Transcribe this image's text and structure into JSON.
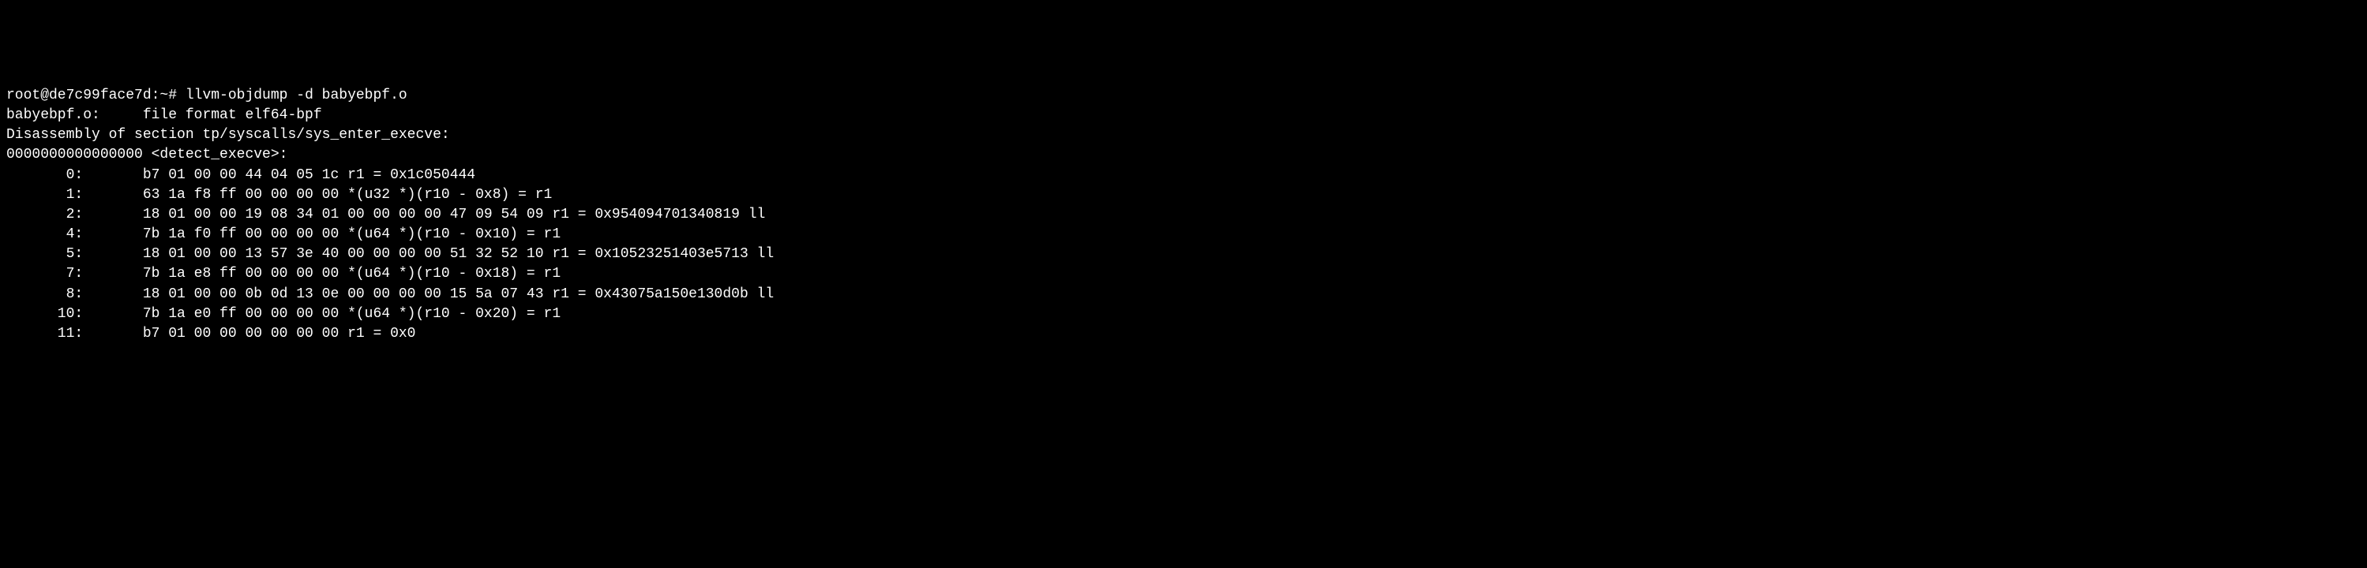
{
  "terminal": {
    "prompt": "root@de7c99face7d:~# ",
    "command": "llvm-objdump -d babyebpf.o",
    "blank1": "",
    "fileinfo": "babyebpf.o:     file format elf64-bpf",
    "blank2": "",
    "section_header": "Disassembly of section tp/syscalls/sys_enter_execve:",
    "blank3": "",
    "function_label": "0000000000000000 <detect_execve>:",
    "instructions": [
      "       0:       b7 01 00 00 44 04 05 1c r1 = 0x1c050444",
      "       1:       63 1a f8 ff 00 00 00 00 *(u32 *)(r10 - 0x8) = r1",
      "       2:       18 01 00 00 19 08 34 01 00 00 00 00 47 09 54 09 r1 = 0x954094701340819 ll",
      "       4:       7b 1a f0 ff 00 00 00 00 *(u64 *)(r10 - 0x10) = r1",
      "       5:       18 01 00 00 13 57 3e 40 00 00 00 00 51 32 52 10 r1 = 0x10523251403e5713 ll",
      "       7:       7b 1a e8 ff 00 00 00 00 *(u64 *)(r10 - 0x18) = r1",
      "       8:       18 01 00 00 0b 0d 13 0e 00 00 00 00 15 5a 07 43 r1 = 0x43075a150e130d0b ll",
      "      10:       7b 1a e0 ff 00 00 00 00 *(u64 *)(r10 - 0x20) = r1",
      "      11:       b7 01 00 00 00 00 00 00 r1 = 0x0"
    ]
  }
}
